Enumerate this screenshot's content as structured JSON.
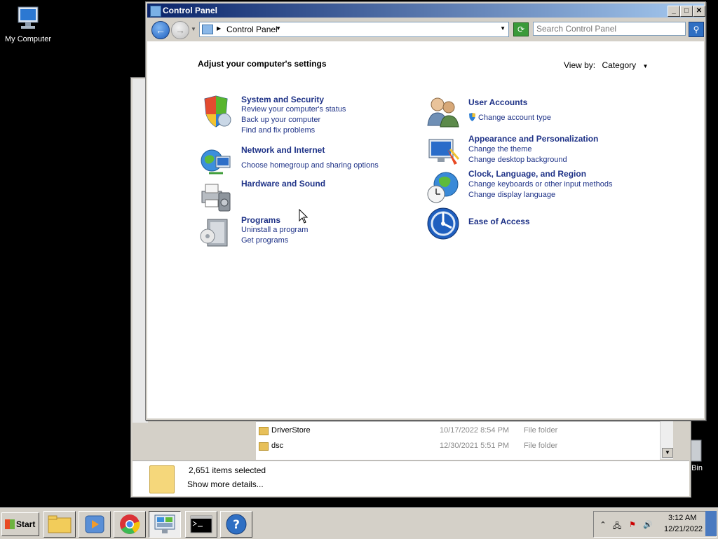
{
  "desktop": {
    "my_computer_label": "My Computer",
    "recycle_bin_label": "Bin"
  },
  "explorer_bg": {
    "files": [
      {
        "name": "DriverStore",
        "date": "10/17/2022 8:54 PM",
        "type": "File folder"
      },
      {
        "name": "dsc",
        "date": "12/30/2021 5:51 PM",
        "type": "File folder"
      }
    ],
    "items_selected": "2,651 items selected",
    "show_more": "Show more details..."
  },
  "control_panel": {
    "title": "Control Panel",
    "address_crumb": "Control Panel",
    "search_placeholder": "Search Control Panel",
    "heading": "Adjust your computer's settings",
    "view_by_label": "View by:",
    "view_by_value": "Category",
    "categories_left": [
      {
        "title": "System and Security",
        "icon": "shield-icon",
        "links": [
          "Review your computer's status",
          "Back up your computer",
          "Find and fix problems"
        ]
      },
      {
        "title": "Network and Internet",
        "icon": "globe-network-icon",
        "links": [
          "Choose homegroup and sharing options"
        ]
      },
      {
        "title": "Hardware and Sound",
        "icon": "printer-speaker-icon",
        "links": []
      },
      {
        "title": "Programs",
        "icon": "programs-box-icon",
        "links": [
          "Uninstall a program",
          "Get programs"
        ]
      }
    ],
    "categories_right": [
      {
        "title": "User Accounts",
        "icon": "users-icon",
        "links": [
          "Change account type"
        ]
      },
      {
        "title": "Appearance and Personalization",
        "icon": "monitor-paint-icon",
        "links": [
          "Change the theme",
          "Change desktop background"
        ]
      },
      {
        "title": "Clock, Language, and Region",
        "icon": "clock-globe-icon",
        "links": [
          "Change keyboards or other input methods",
          "Change display language"
        ]
      },
      {
        "title": "Ease of Access",
        "icon": "ease-of-access-icon",
        "links": []
      }
    ]
  },
  "taskbar": {
    "start_label": "Start",
    "time": "3:12 AM",
    "date": "12/21/2022"
  },
  "colors": {
    "link_blue": "#1e3287",
    "title_gradient_start": "#0a246a",
    "title_gradient_end": "#a6caf0",
    "desktop_bg": "#000000",
    "chrome_gray": "#d4d0c8"
  }
}
